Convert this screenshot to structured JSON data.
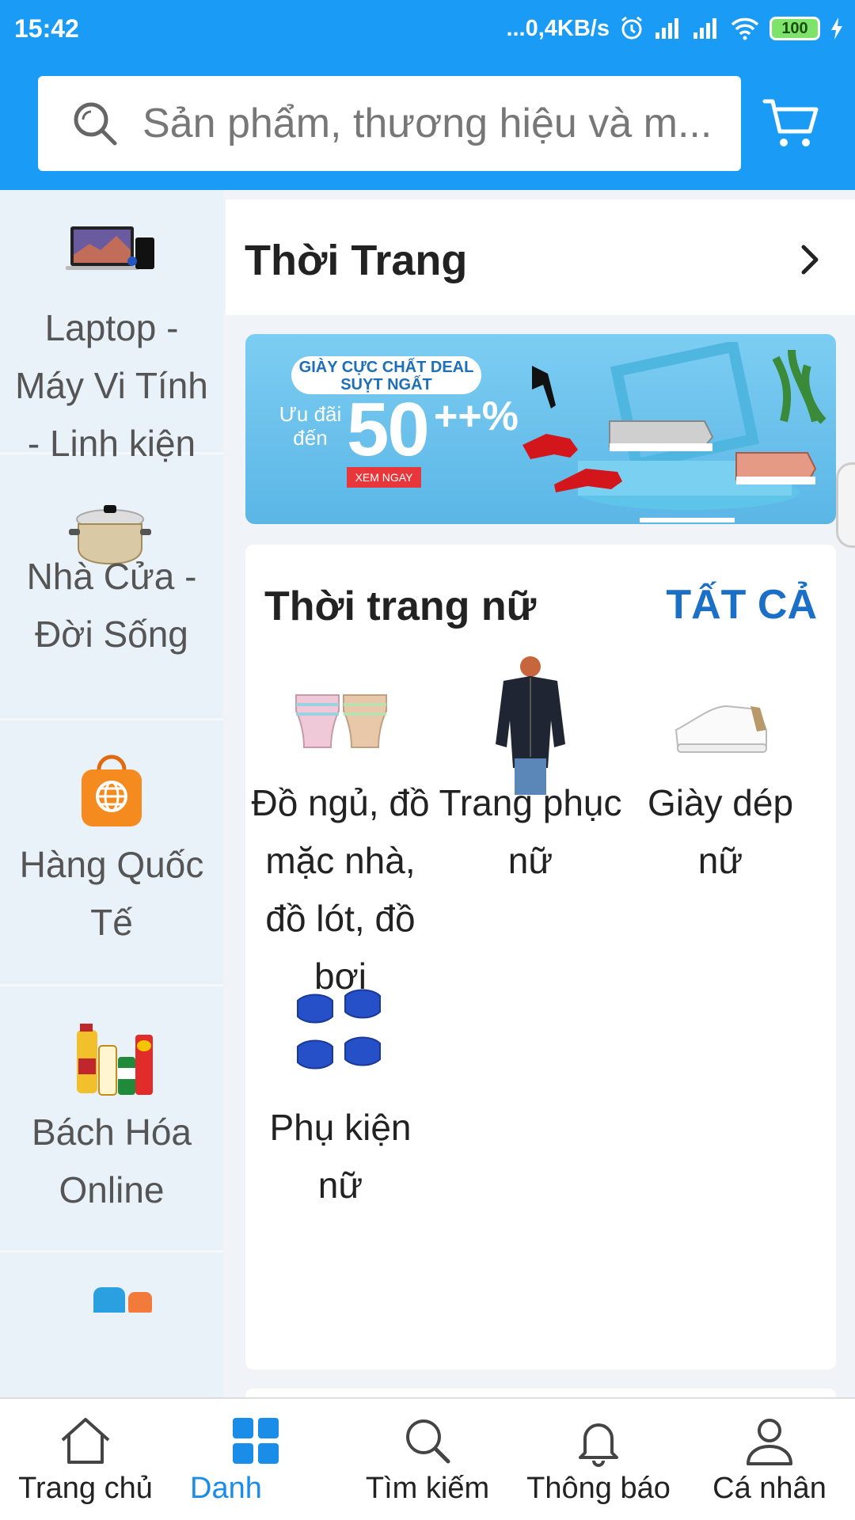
{
  "status_bar": {
    "time": "15:42",
    "network_speed": "...0,4KB/s",
    "battery": "100"
  },
  "search": {
    "placeholder": "Sản phẩm, thương hiệu và m..."
  },
  "categories": [
    {
      "label": "Laptop - Máy Vi Tính - Linh kiện",
      "icon": "laptop-image"
    },
    {
      "label": "Nhà Cửa - Đời Sống",
      "icon": "cooking-pot-image"
    },
    {
      "label": "Hàng Quốc Tế",
      "icon": "global-shopping-bag-image"
    },
    {
      "label": "Bách Hóa Online",
      "icon": "grocery-image"
    }
  ],
  "section": {
    "title": "Thời Trang"
  },
  "banner": {
    "tagline": "GIÀY CỰC CHẤT DEAL SUỴT NGẤT",
    "offer_prefix": "Ưu đãi đến",
    "offer_value": "50",
    "offer_suffix": "++%",
    "cta": "XEM NGAY"
  },
  "subcategory_card": {
    "title": "Thời trang nữ",
    "see_all": "TẤT CẢ",
    "items": [
      {
        "label": "Đồ ngủ, đồ mặc nhà, đồ lót, đồ bơi",
        "icon": "underwear-image"
      },
      {
        "label": "Trang phục nữ",
        "icon": "jacket-image"
      },
      {
        "label": "Giày dép nữ",
        "icon": "sneaker-image"
      },
      {
        "label": "Phụ kiện nữ",
        "icon": "face-mask-image"
      }
    ]
  },
  "bottom_nav": [
    {
      "label": "Trang chủ",
      "icon": "home-icon",
      "active": false
    },
    {
      "label": "Danh",
      "icon": "grid-icon",
      "active": true
    },
    {
      "label": "Tìm kiếm",
      "icon": "search-icon",
      "active": false
    },
    {
      "label": "Thông báo",
      "icon": "bell-icon",
      "active": false
    },
    {
      "label": "Cá nhân",
      "icon": "person-icon",
      "active": false
    }
  ],
  "colors": {
    "header": "#1a9bf5",
    "accent": "#1a8de8",
    "see_all": "#1a6fc6",
    "sidebar_bg": "#e9f1f9"
  }
}
